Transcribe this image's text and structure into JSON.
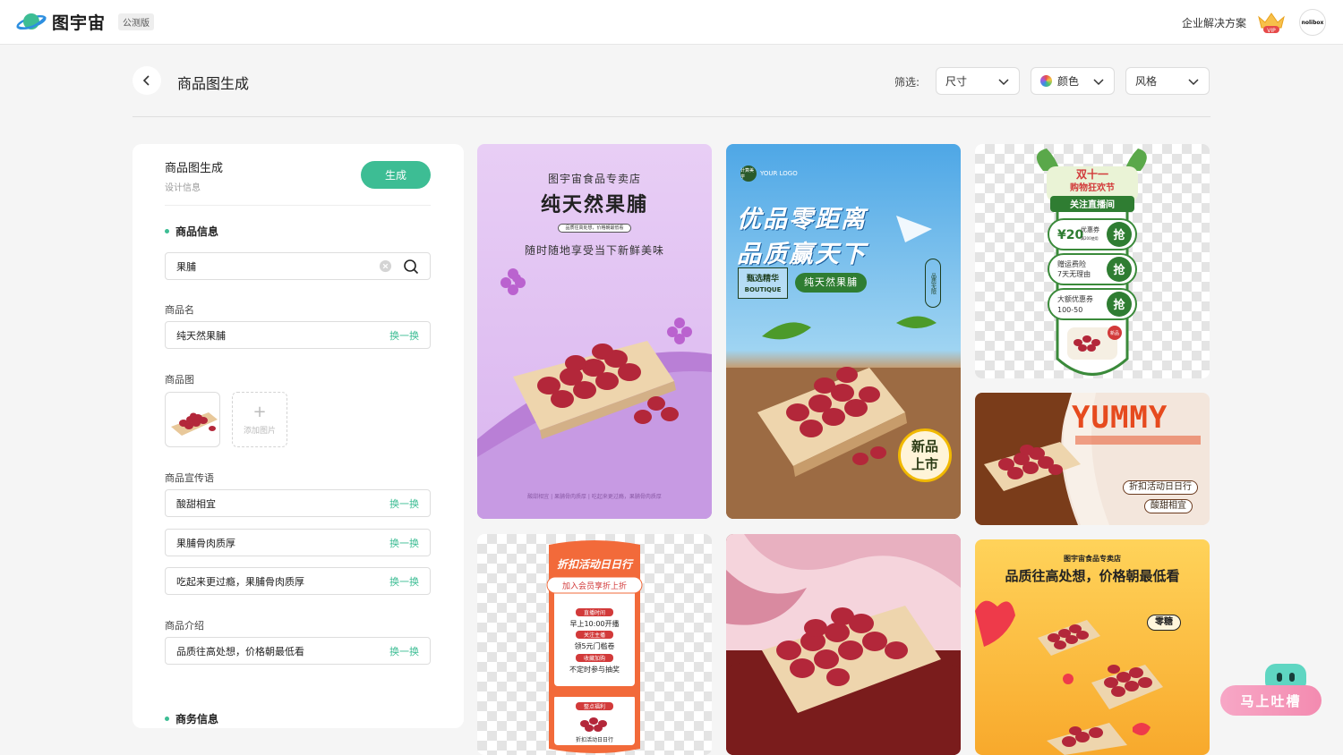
{
  "topbar": {
    "brand_name": "图宇宙",
    "brand_tag": "公测版",
    "enterprise_link": "企业解决方案",
    "vip_label": "VIP",
    "avatar_text": "nolibox"
  },
  "header": {
    "title": "商品图生成",
    "filter_label": "筛选:",
    "filters": [
      "尺寸",
      "颜色",
      "风格"
    ]
  },
  "panel": {
    "title": "商品图生成",
    "subtitle": "设计信息",
    "generate_label": "生成",
    "section_product": "商品信息",
    "search_value": "果脯",
    "name_label": "商品名",
    "name_value": "纯天然果脯",
    "swap_label": "换一换",
    "image_label": "商品图",
    "add_image_label": "添加图片",
    "slogan_label": "商品宣传语",
    "slogans": [
      "酸甜相宜",
      "果脯骨肉质厚",
      "吃起来更过瘾，果脯骨肉质厚"
    ],
    "intro_label": "商品介绍",
    "intro_value": "品质往高处想，价格朝最低看",
    "section_business": "商务信息"
  },
  "cards": {
    "c1": {
      "store": "图宇宙食品专卖店",
      "title": "纯天然果脯",
      "tag": "品质往高处想，价格朝最低看",
      "slogan": "随时随地享受当下新鲜美味",
      "footer": "酸甜相宜 | 果脯骨肉质厚 | 吃起来更过瘾，果脯骨肉质厚"
    },
    "c2": {
      "logo_mark": "计算美学",
      "logo_text": "YOUR LOGO",
      "headline1": "优品零距离",
      "headline2": "品质赢天下",
      "boutique_cn": "甄选精华",
      "boutique_en": "BOUTIQUE",
      "pill": "纯天然果脯",
      "vertical": "品质无限",
      "badge_top": "新品",
      "badge_bottom": "上市"
    },
    "c3": {
      "title1": "双十一",
      "title2": "购物狂欢节",
      "live": "关注直播间",
      "coupon_amount": "¥20",
      "coupon_name": "优惠券",
      "coupon_rule": "满200使用",
      "grab": "抢",
      "row2_line1": "赠运费险",
      "row2_line2": "7天无理由",
      "row3_line1": "大额优惠券",
      "row3_line2": "100-50",
      "new_tag": "新品"
    },
    "c4": {
      "brand": "YUMMY",
      "tag1": "折扣活动日日行",
      "tag2": "酸甜相宜"
    },
    "c5": {
      "title": "折扣活动日日行",
      "subtitle": "加入会员享折上折",
      "t1": "直播时间",
      "l1": "早上10:00开播",
      "t2": "关注主播",
      "l2": "领5元门槛卷",
      "t3": "收藏加购",
      "l3": "不定时参与抽奖",
      "t4": "整点福利",
      "footer": "折扣活动日日行"
    },
    "c7": {
      "store": "图宇宙食品专卖店",
      "title": "品质往高处想，价格朝最低看",
      "pill": "零糖"
    }
  },
  "feedback": {
    "label": "马上吐槽"
  },
  "colors": {
    "accent": "#3dbd94",
    "card1_bg": "#e1c3f2",
    "sale_red": "#e64a1e"
  }
}
